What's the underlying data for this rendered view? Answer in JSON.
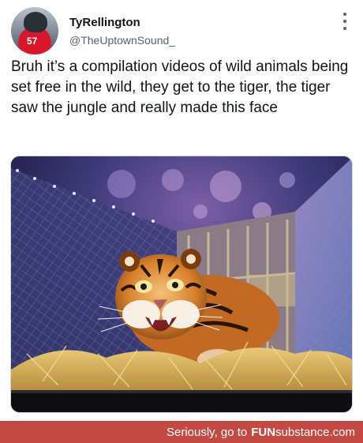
{
  "tweet": {
    "display_name": "TyRellington",
    "handle": "@TheUptownSound_",
    "avatar_jersey": "57",
    "more_icon": "more-vertical-icon",
    "text": "Bruh it’s a compilation videos of wild animals being set free in the wild, they get to the tiger, the tiger saw the jungle and really made this face"
  },
  "media": {
    "subject": "tiger-in-crate-photo"
  },
  "footer": {
    "prefix": "Seriously, go to",
    "brand_part1": "FUN",
    "brand_part2": "substance",
    "brand_part3": ".com",
    "background_color": "#c24a43"
  }
}
